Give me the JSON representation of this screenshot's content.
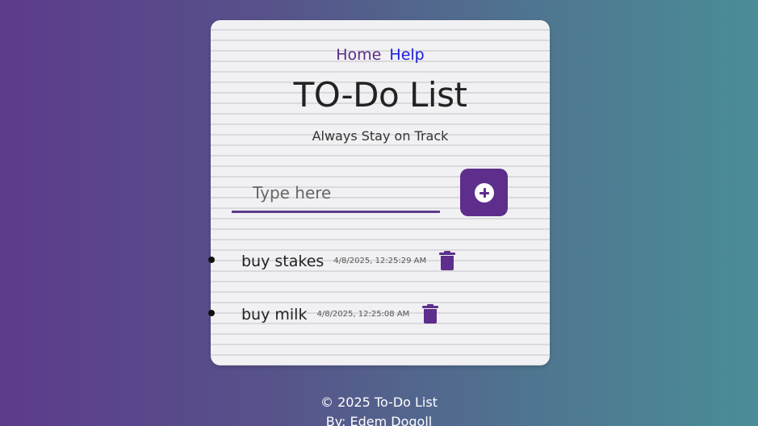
{
  "nav": {
    "home_label": "Home",
    "help_label": "Help"
  },
  "header": {
    "title": "TO-Do List",
    "subtitle": "Always Stay on Track"
  },
  "input": {
    "placeholder": "Type here",
    "value": ""
  },
  "add_button": {
    "icon": "plus-circle-icon"
  },
  "tasks": [
    {
      "text": "buy stakes",
      "timestamp": "4/8/2025, 12:25:29 AM",
      "delete_icon": "trash-icon"
    },
    {
      "text": "buy milk",
      "timestamp": "4/8/2025, 12:25:08 AM",
      "delete_icon": "trash-icon"
    }
  ],
  "footer": {
    "copyright": "© 2025 To-Do List",
    "byline": "By: Edem Dogoll"
  },
  "colors": {
    "accent": "#5d2e8c",
    "help_link": "#1a1adb",
    "bg_gradient_start": "#5d3b8c",
    "bg_gradient_end": "#4a8d97"
  }
}
